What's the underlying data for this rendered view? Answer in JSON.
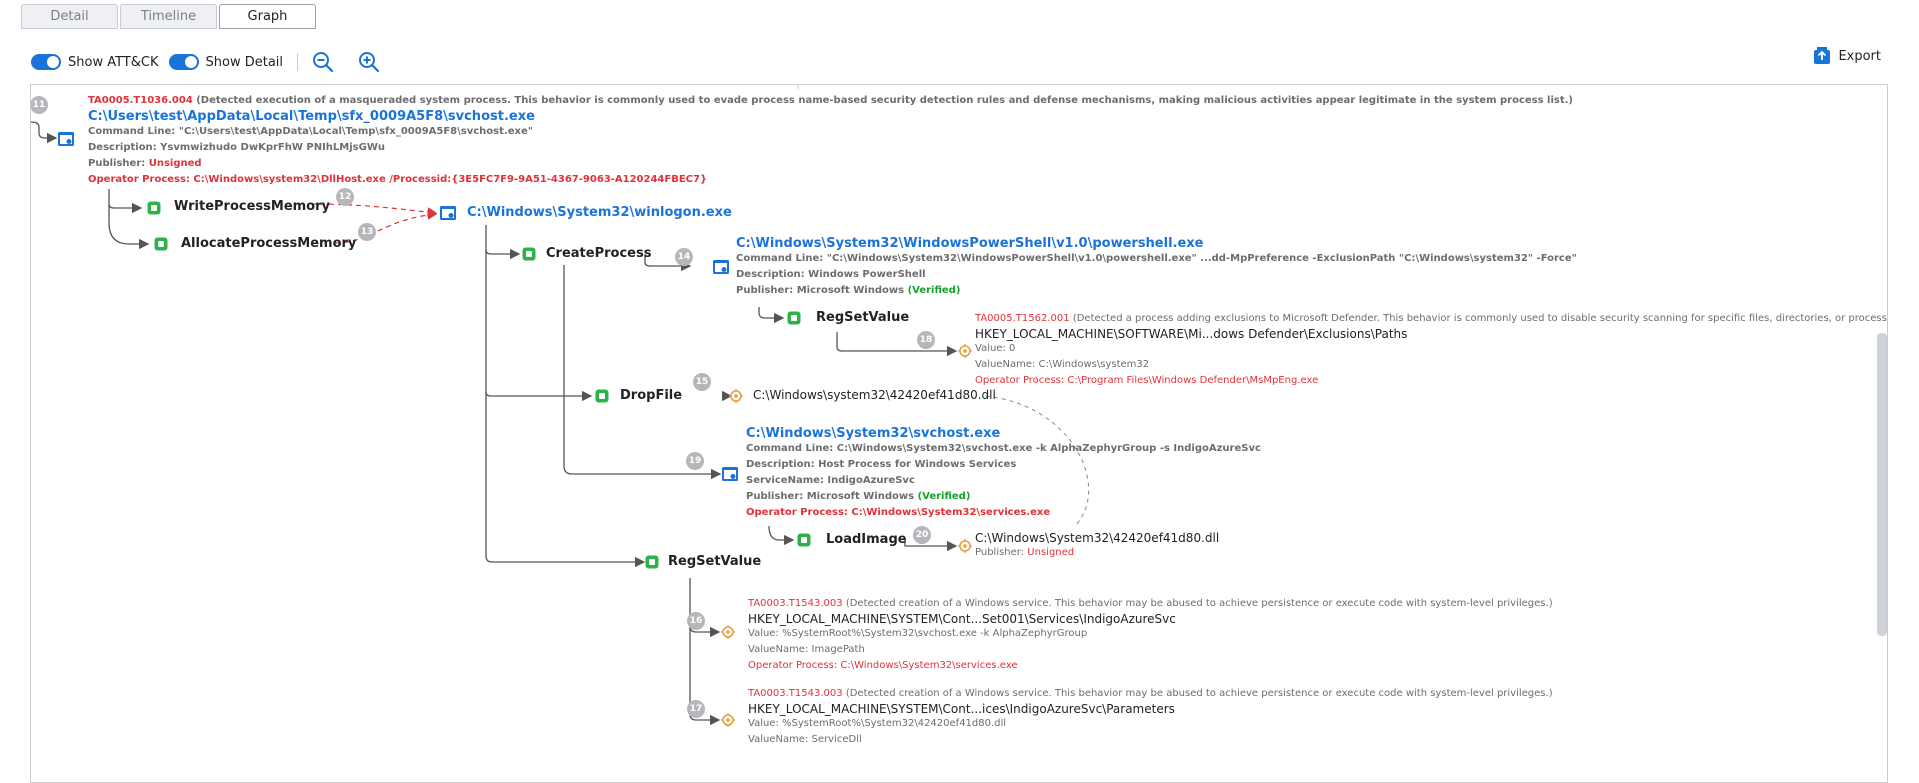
{
  "tabs": [
    {
      "label": "Detail",
      "active": false
    },
    {
      "label": "Timeline",
      "active": false
    },
    {
      "label": "Graph",
      "active": true
    }
  ],
  "toolbar": {
    "show_attck_label": "Show ATT&CK",
    "show_attck_on": true,
    "show_detail_label": "Show Detail",
    "show_detail_on": true,
    "export_label": "Export",
    "accent_color": "#1a73d9"
  },
  "graph": {
    "root": {
      "ttp_id": "TA0005.T1036.004",
      "ttp_desc": "(Detected execution of a masqueraded system process. This behavior is commonly used to evade process name-based security detection rules and defense mechanisms, making malicious activities appear legitimate in the system process list.)",
      "badge": "11",
      "path": "C:\\Users\\test\\AppData\\Local\\Temp\\sfx_0009A5F8\\svchost.exe",
      "command_line": "Command Line: \"C:\\Users\\test\\AppData\\Local\\Temp\\sfx_0009A5F8\\svchost.exe\"",
      "description": "Description: Ysvmwizhudo DwKprFhW PNIhLMjsGWu",
      "publisher_label": "Publisher:",
      "publisher_value": "Unsigned",
      "operator_process": "Operator Process: C:\\Windows\\system32\\DllHost.exe /Processid:{3E5FC7F9-9A51-4367-9063-A120244FBEC7}"
    },
    "write_process_memory": {
      "label": "WriteProcessMemory",
      "badge": "12"
    },
    "allocate_process_memory": {
      "label": "AllocateProcessMemory",
      "badge": "13"
    },
    "winlogon": {
      "path": "C:\\Windows\\System32\\winlogon.exe"
    },
    "create_process": {
      "label": "CreateProcess"
    },
    "powershell": {
      "badge": "14",
      "path": "C:\\Windows\\System32\\WindowsPowerShell\\v1.0\\powershell.exe",
      "command_line": "Command Line: \"C:\\Windows\\System32\\WindowsPowerShell\\v1.0\\powershell.exe\" ...dd-MpPreference -ExclusionPath \"C:\\Windows\\system32\" -Force\"",
      "description": "Description: Windows PowerShell",
      "publisher_label": "Publisher: Microsoft Windows",
      "publisher_status": "(Verified)"
    },
    "ps_regsetvalue": {
      "label": "RegSetValue",
      "badge": "18",
      "ttp_id": "TA0005.T1562.001",
      "ttp_desc": "(Detected a process adding exclusions to Microsoft Defender. This behavior is commonly used to disable security scanning for specific files, directories, or processes and evade de",
      "key": "HKEY_LOCAL_MACHINE\\SOFTWARE\\Mi...dows Defender\\Exclusions\\Paths",
      "value": "Value: 0",
      "value_name": "ValueName: C:\\Windows\\system32",
      "operator_process": "Operator Process: C:\\Program Files\\Windows Defender\\MsMpEng.exe"
    },
    "drop_file": {
      "label": "DropFile",
      "badge": "15",
      "target": "C:\\Windows\\system32\\42420ef41d80.dll"
    },
    "svchost": {
      "badge": "19",
      "path": "C:\\Windows\\System32\\svchost.exe",
      "command_line": "Command Line: C:\\Windows\\System32\\svchost.exe -k AlphaZephyrGroup -s IndigoAzureSvc",
      "description": "Description: Host Process for Windows Services",
      "service_name": "ServiceName: IndigoAzureSvc",
      "publisher_label": "Publisher: Microsoft Windows",
      "publisher_status": "(Verified)",
      "operator_process": "Operator Process: C:\\Windows\\System32\\services.exe"
    },
    "load_image": {
      "label": "LoadImage",
      "badge": "20",
      "target": "C:\\Windows\\System32\\42420ef41d80.dll",
      "publisher_label": "Publisher:",
      "publisher_value": "Unsigned"
    },
    "winlogon_regsetvalue": {
      "label": "RegSetValue"
    },
    "reg16": {
      "badge": "16",
      "ttp_id": "TA0003.T1543.003",
      "ttp_desc": "(Detected creation of a Windows service. This behavior may be abused to achieve persistence or execute code with system-level privileges.)",
      "key": "HKEY_LOCAL_MACHINE\\SYSTEM\\Cont...Set001\\Services\\IndigoAzureSvc",
      "value": "Value: %SystemRoot%\\System32\\svchost.exe -k AlphaZephyrGroup",
      "value_name": "ValueName: ImagePath",
      "operator_process": "Operator Process: C:\\Windows\\System32\\services.exe"
    },
    "reg17": {
      "badge": "17",
      "ttp_id": "TA0003.T1543.003",
      "ttp_desc": "(Detected creation of a Windows service. This behavior may be abused to achieve persistence or execute code with system-level privileges.)",
      "key": "HKEY_LOCAL_MACHINE\\SYSTEM\\Cont...ices\\IndigoAzureSvc\\Parameters",
      "value": "Value: %SystemRoot%\\System32\\42420ef41d80.dll",
      "value_name": "ValueName: ServiceDll"
    }
  }
}
